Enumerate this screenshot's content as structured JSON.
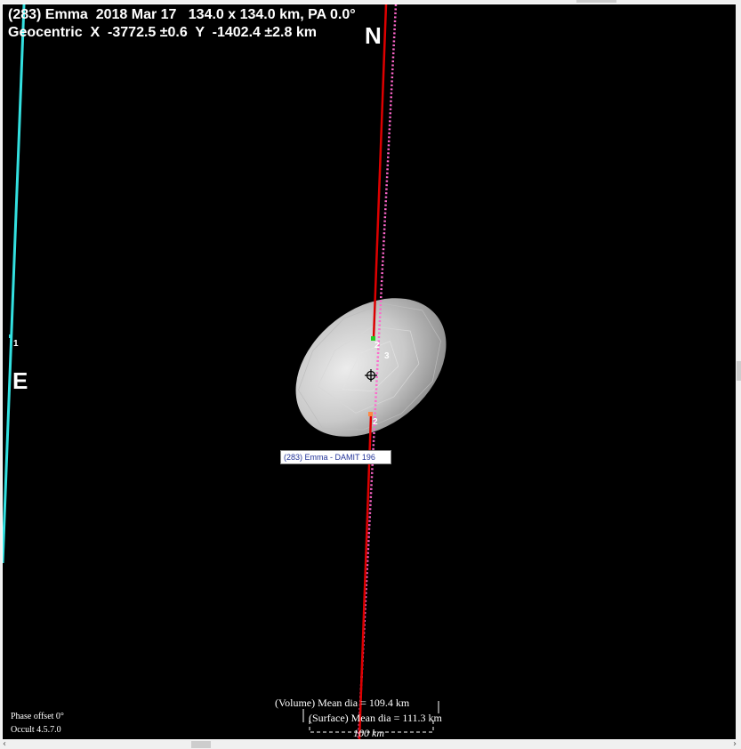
{
  "header": {
    "line1": "(283) Emma  2018 Mar 17   134.0 x 134.0 km, PA 0.0°",
    "line2": "Geocentric  X  -3772.5 ±0.6  Y  -1402.4 ±2.8 km"
  },
  "compass": {
    "north": "N",
    "east": "E"
  },
  "model_label": "(283) Emma - DAMIT 196",
  "chord_labels": {
    "c1": "1",
    "c2a": "2",
    "c3": "3",
    "c2b": "2"
  },
  "diameters": {
    "volume": "(Volume) Mean dia = 109.4 km",
    "surface": "(Surface) Mean dia = 111.3 km"
  },
  "scale_bar": "100 km",
  "footer": {
    "phase": "Phase offset 0°",
    "version": "Occult 4.5.7.0"
  },
  "colors": {
    "background": "#000000",
    "chord_red": "#dd0000",
    "chord_cyan": "#33e0e0",
    "chord_pink": "#ff66cc",
    "asteroid": "#d9d9d9"
  }
}
